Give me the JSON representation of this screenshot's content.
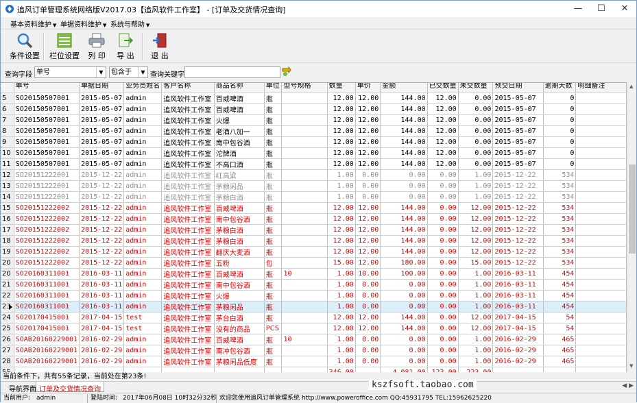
{
  "window": {
    "title": "追风订单管理系统网络版V2017.03【追风软件工作室】 - [订单及交货情况查询]",
    "minimize": "—",
    "maximize": "☐",
    "close": "✕"
  },
  "menu": [
    {
      "label": "基本资料维护"
    },
    {
      "label": "单据资料维护"
    },
    {
      "label": "系统与帮助"
    }
  ],
  "toolbar": {
    "filter_label": "条件设置",
    "columns_label": "栏位设置",
    "print_label": "列 印",
    "export_label": "导 出",
    "exit_label": "退 出"
  },
  "query": {
    "field_label": "查询字段",
    "field_value": "单号",
    "op_value": "包含于",
    "keyword_label": "查询关键字",
    "keyword_value": ""
  },
  "columns": [
    "",
    "单号",
    "单据日期",
    "业务员姓名",
    "客户名称",
    "商品名称",
    "单位",
    "型号规格",
    "数量",
    "单价",
    "金额",
    "已交数量",
    "未交数量",
    "预交日期",
    "逾期天数",
    "明细备注"
  ],
  "rows": [
    {
      "style": "black",
      "cells": [
        "5",
        "SO20150507001",
        "2015-05-07",
        "admin",
        "追风软件工作室",
        "百威啤酒",
        "瓶",
        "",
        "12.00",
        "12.00",
        "144.00",
        "12.00",
        "0.00",
        "2015-05-07",
        "0",
        ""
      ]
    },
    {
      "style": "black",
      "cells": [
        "6",
        "SO20150507001",
        "2015-05-07",
        "admin",
        "追风软件工作室",
        "百威啤酒",
        "瓶",
        "",
        "12.00",
        "12.00",
        "144.00",
        "12.00",
        "0.00",
        "2015-05-07",
        "0",
        ""
      ]
    },
    {
      "style": "black",
      "cells": [
        "7",
        "SO20150507001",
        "2015-05-07",
        "admin",
        "追风软件工作室",
        "火爆",
        "瓶",
        "",
        "12.00",
        "12.00",
        "144.00",
        "12.00",
        "0.00",
        "2015-05-07",
        "0",
        ""
      ]
    },
    {
      "style": "black",
      "cells": [
        "8",
        "SO20150507001",
        "2015-05-07",
        "admin",
        "追风软件工作室",
        "老酒八加一",
        "瓶",
        "",
        "12.00",
        "12.00",
        "144.00",
        "12.00",
        "0.00",
        "2015-05-07",
        "0",
        ""
      ]
    },
    {
      "style": "black",
      "cells": [
        "9",
        "SO20150507001",
        "2015-05-07",
        "admin",
        "追风软件工作室",
        "南中包谷酒",
        "瓶",
        "",
        "12.00",
        "12.00",
        "144.00",
        "12.00",
        "0.00",
        "2015-05-07",
        "0",
        ""
      ]
    },
    {
      "style": "black",
      "cells": [
        "10",
        "SO20150507001",
        "2015-05-07",
        "admin",
        "追风软件工作室",
        "沱牌酒",
        "瓶",
        "",
        "12.00",
        "12.00",
        "144.00",
        "12.00",
        "0.00",
        "2015-05-07",
        "0",
        ""
      ]
    },
    {
      "style": "black",
      "cells": [
        "11",
        "SO20150507001",
        "2015-05-07",
        "admin",
        "追风软件工作室",
        "不高口酒",
        "瓶",
        "",
        "12.00",
        "12.00",
        "144.00",
        "12.00",
        "0.00",
        "2015-05-07",
        "0",
        ""
      ]
    },
    {
      "style": "gray",
      "cells": [
        "12",
        "SO20151222001",
        "2015-12-22",
        "admin",
        "追风软件工作室",
        "红高粱",
        "瓶",
        "",
        "1.00",
        "0.00",
        "0.00",
        "0.00",
        "1.00",
        "2015-12-22",
        "534",
        ""
      ]
    },
    {
      "style": "gray",
      "cells": [
        "13",
        "SO20151222001",
        "2015-12-22",
        "admin",
        "追风软件工作室",
        "茅粮闲品",
        "瓶",
        "",
        "1.00",
        "0.00",
        "0.00",
        "0.00",
        "1.00",
        "2015-12-22",
        "534",
        ""
      ]
    },
    {
      "style": "gray",
      "cells": [
        "14",
        "SO20151222001",
        "2015-12-22",
        "admin",
        "追风软件工作室",
        "茅粮白酒",
        "瓶",
        "",
        "1.00",
        "0.00",
        "0.00",
        "0.00",
        "1.00",
        "2015-12-22",
        "534",
        ""
      ]
    },
    {
      "style": "red",
      "cells": [
        "15",
        "SO20151222002",
        "2015-12-22",
        "admin",
        "追风软件工作室",
        "百威啤酒",
        "瓶",
        "",
        "12.00",
        "12.00",
        "144.00",
        "0.00",
        "12.00",
        "2015-12-22",
        "534",
        ""
      ]
    },
    {
      "style": "red",
      "cells": [
        "16",
        "SO20151222002",
        "2015-12-22",
        "admin",
        "追风软件工作室",
        "南中包谷酒",
        "瓶",
        "",
        "12.00",
        "12.00",
        "144.00",
        "0.00",
        "12.00",
        "2015-12-22",
        "534",
        ""
      ]
    },
    {
      "style": "red",
      "cells": [
        "17",
        "SO20151222002",
        "2015-12-22",
        "admin",
        "追风软件工作室",
        "茅粮白酒",
        "瓶",
        "",
        "12.00",
        "12.00",
        "144.00",
        "0.00",
        "12.00",
        "2015-12-22",
        "534",
        ""
      ]
    },
    {
      "style": "red",
      "cells": [
        "18",
        "SO20151222002",
        "2015-12-22",
        "admin",
        "追风软件工作室",
        "茅粮白酒",
        "瓶",
        "",
        "12.00",
        "12.00",
        "144.00",
        "0.00",
        "12.00",
        "2015-12-22",
        "534",
        ""
      ]
    },
    {
      "style": "red",
      "cells": [
        "19",
        "SO20151222002",
        "2015-12-22",
        "admin",
        "追风软件工作室",
        "翻庆大麦酒",
        "瓶",
        "",
        "12.00",
        "12.00",
        "144.00",
        "0.00",
        "12.00",
        "2015-12-22",
        "534",
        ""
      ]
    },
    {
      "style": "red",
      "cells": [
        "20",
        "SO20151222002",
        "2015-12-22",
        "admin",
        "追风软件工作室",
        "五粉",
        "包",
        "",
        "15.00",
        "12.00",
        "180.00",
        "0.00",
        "15.00",
        "2015-12-22",
        "534",
        ""
      ]
    },
    {
      "style": "red",
      "cells": [
        "20",
        "SO20160311001",
        "2016-03-11",
        "admin",
        "追风软件工作室",
        "百威啤酒",
        "瓶",
        "10",
        "1.00",
        "10.00",
        "100.00",
        "0.00",
        "1.00",
        "2016-03-11",
        "454",
        ""
      ]
    },
    {
      "style": "red",
      "cells": [
        "21",
        "SO20160311001",
        "2016-03-11",
        "admin",
        "追风软件工作室",
        "南中包谷酒",
        "瓶",
        "",
        "1.00",
        "0.00",
        "0.00",
        "0.00",
        "1.00",
        "2016-03-11",
        "454",
        ""
      ]
    },
    {
      "style": "red",
      "cells": [
        "22",
        "SO20160311001",
        "2016-03-11",
        "admin",
        "追风软件工作室",
        "火爆",
        "瓶",
        "",
        "1.00",
        "0.00",
        "0.00",
        "0.00",
        "1.00",
        "2016-03-11",
        "454",
        ""
      ]
    },
    {
      "style": "red sel",
      "cells": [
        "23",
        "SO20160311001",
        "2016-03-11",
        "admin",
        "追风软件工作室",
        "茅粮闲品",
        "瓶",
        "",
        "1.00",
        "0.00",
        "0.00",
        "0.00",
        "1.00",
        "2016-03-11",
        "454",
        ""
      ]
    },
    {
      "style": "red",
      "cells": [
        "24",
        "SO20170415001",
        "2017-04-15",
        "test",
        "追风软件工作室",
        "茅台白酒",
        "瓶",
        "",
        "12.00",
        "12.00",
        "144.00",
        "0.00",
        "12.00",
        "2017-04-15",
        "54",
        ""
      ]
    },
    {
      "style": "red",
      "cells": [
        "25",
        "SO20170415001",
        "2017-04-15",
        "test",
        "追风软件工作室",
        "没有的商品",
        "PCS",
        "",
        "12.00",
        "12.00",
        "144.00",
        "0.00",
        "12.00",
        "2017-04-15",
        "54",
        ""
      ]
    },
    {
      "style": "red",
      "cells": [
        "26",
        "SOAB20160229001",
        "2016-02-29",
        "admin",
        "追风软件工作室",
        "百威啤酒",
        "瓶",
        "10",
        "1.00",
        "0.00",
        "0.00",
        "0.00",
        "1.00",
        "2016-02-29",
        "465",
        ""
      ]
    },
    {
      "style": "red",
      "cells": [
        "27",
        "SOAB20160229001",
        "2016-02-29",
        "admin",
        "追风软件工作室",
        "南冲包谷酒",
        "瓶",
        "",
        "1.00",
        "0.00",
        "0.00",
        "0.00",
        "1.00",
        "2016-02-29",
        "465",
        ""
      ]
    },
    {
      "style": "red",
      "cells": [
        "28",
        "SOAB20160229001",
        "2016-02-29",
        "admin",
        "追风软件工作室",
        "茅粮闲品低度",
        "瓶",
        "",
        "1.00",
        "0.00",
        "0.00",
        "0.00",
        "1.00",
        "2016-02-29",
        "465",
        ""
      ]
    }
  ],
  "footer": [
    "55",
    "",
    "",
    "",
    "",
    "",
    "",
    "",
    "346.00",
    "",
    "4,081.00",
    "123.00",
    "223.00",
    "",
    "",
    ""
  ],
  "status_text": "当前条件下，共有55条记录，当前处在第23条!",
  "tabs": [
    {
      "label": "导航界面"
    },
    {
      "label": "订单及交货情况查询"
    }
  ],
  "watermark": "kszfsoft.taobao.com",
  "bottom": {
    "user_label": "当前用户:",
    "user_value": "admin",
    "login_label": "登陆时间:",
    "login_value": "2017年06月08日 10时32分32秒",
    "welcome": "欢迎您使用追风订单管理系统 http://www.poweroffice.com QQ:45931795 TEL:15962625220"
  }
}
